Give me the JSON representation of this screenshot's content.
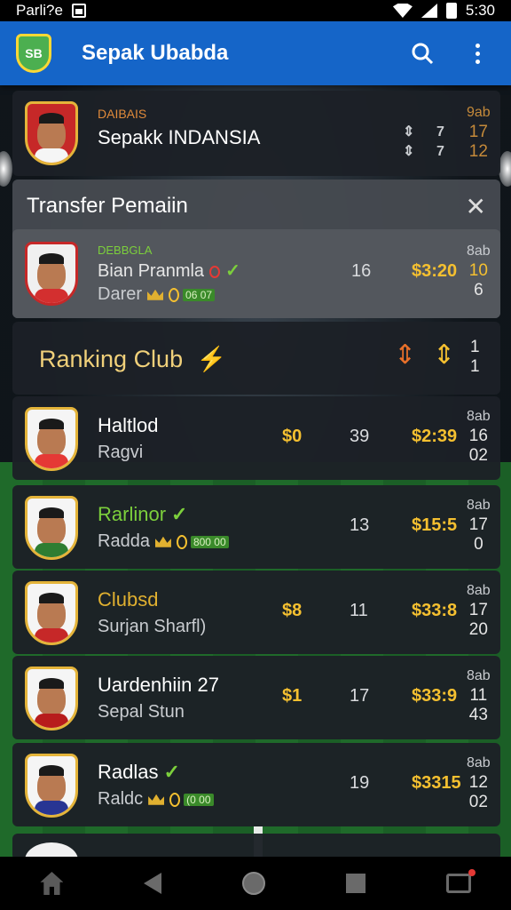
{
  "status_bar": {
    "left_text": "Parli?e",
    "time": "5:30"
  },
  "app_bar": {
    "logo_text": "SB",
    "title": "Sepak Ubabda"
  },
  "header_card": {
    "label": "DAIBAIS",
    "title": "Sepakk INDANSIA",
    "col1": [
      "⇕",
      "⇕"
    ],
    "col2": [
      "7",
      "7"
    ],
    "col3": [
      "9ab",
      "17",
      "12"
    ]
  },
  "transfer_section": {
    "title": "Transfer Pemaiin",
    "item": {
      "label": "DEBBGLA",
      "name": "Bian Pranmla",
      "sub": "Darer",
      "chip": "06 07",
      "stat": "16",
      "price": "$3:20",
      "col": [
        "8ab",
        "10",
        "6"
      ]
    }
  },
  "ranking_section": {
    "title": "Ranking Club",
    "col": [
      "1",
      "1"
    ]
  },
  "clubs": [
    {
      "name": "Haltlod",
      "sub": "Ragvi",
      "gold": "$0",
      "stat": "39",
      "price": "$2:39",
      "col": [
        "8ab",
        "16",
        "02"
      ],
      "name_color": "#ffffff",
      "shirt": "#e53935"
    },
    {
      "name": "Rarlinor",
      "sub": "Radda",
      "chip": "800 00",
      "gold": "",
      "stat": "13",
      "price": "$15:5",
      "col": [
        "8ab",
        "17",
        "0"
      ],
      "name_color": "#7ccf3c",
      "shirt": "#2e7d32"
    },
    {
      "name": "Clubsd",
      "sub": "Surjan Sharfl)",
      "gold": "$8",
      "stat": "11",
      "price": "$33:8",
      "col": [
        "8ab",
        "17",
        "20"
      ],
      "name_color": "#e0b030",
      "shirt": "#c62828"
    },
    {
      "name": "Uardenhiin 27",
      "sub": "Sepal Stun",
      "gold": "$1",
      "stat": "17",
      "price": "$33:9",
      "col": [
        "8ab",
        "11",
        "43"
      ],
      "name_color": "#ffffff",
      "shirt": "#b71c1c"
    },
    {
      "name": "Radlas",
      "sub": "Raldc",
      "chip": "(0 00",
      "gold": "",
      "stat": "19",
      "price": "$3315",
      "col": [
        "8ab",
        "12",
        "02"
      ],
      "name_color": "#ffffff",
      "shirt": "#283593"
    }
  ],
  "colors": {
    "app_bar": "#1565c8",
    "gold": "#f5c030",
    "green": "#7ccf3c"
  }
}
